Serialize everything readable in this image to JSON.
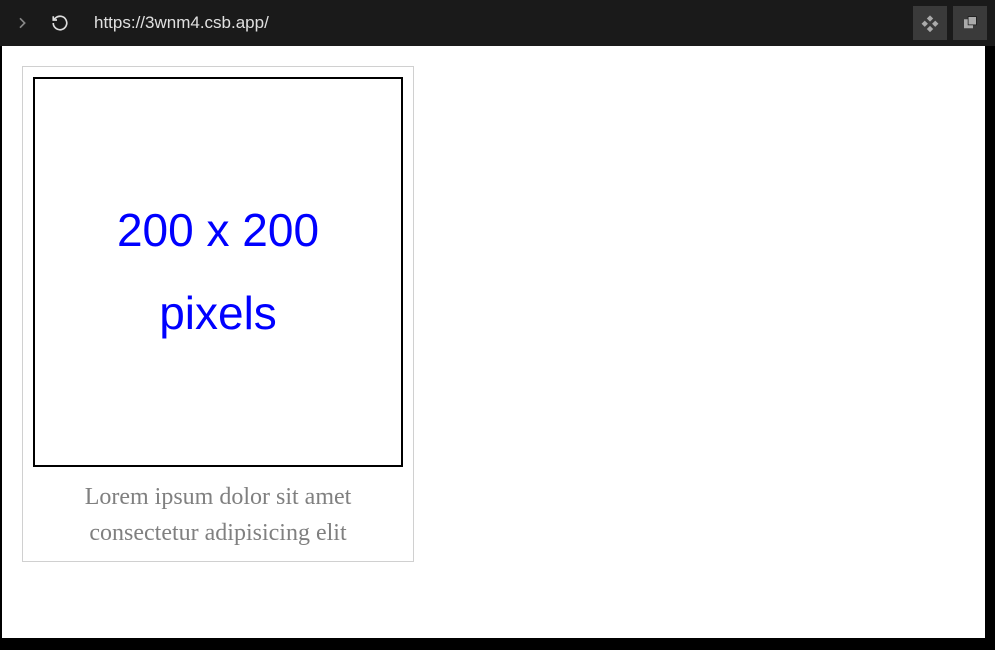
{
  "browser": {
    "url": "https://3wnm4.csb.app/"
  },
  "content": {
    "placeholder": {
      "line1": "200 x 200",
      "line2": "pixels"
    },
    "caption": "Lorem ipsum dolor sit amet consectetur adipisicing elit"
  }
}
